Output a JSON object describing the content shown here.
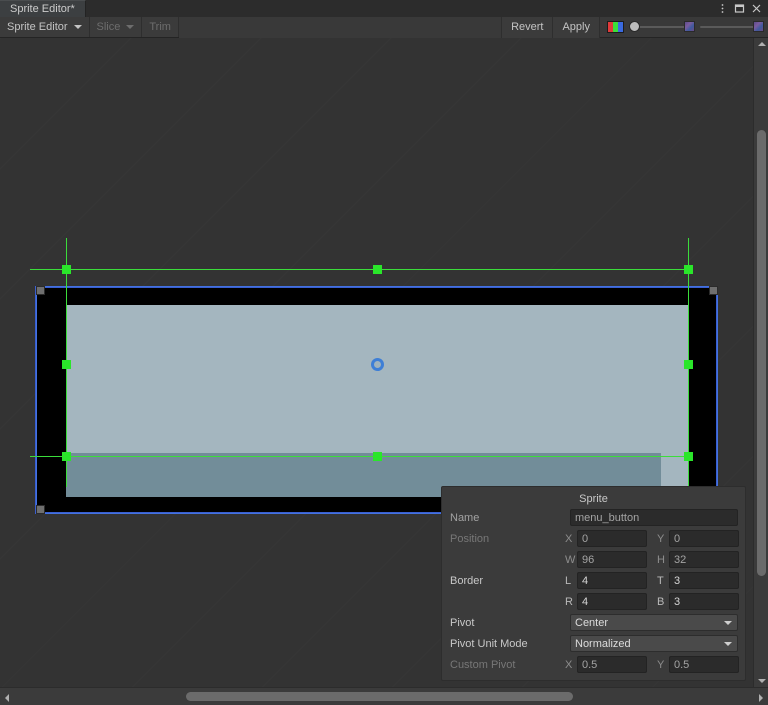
{
  "window": {
    "tab_label": "Sprite Editor*",
    "controls": [
      {
        "name": "kebab-menu",
        "glyph": "⋮"
      },
      {
        "name": "maximize",
        "glyph": "□"
      },
      {
        "name": "close",
        "glyph": "✕"
      }
    ]
  },
  "toolbar": {
    "editor_menu": "Sprite Editor",
    "slice_menu": "Slice",
    "trim_button": "Trim",
    "revert_button": "Revert",
    "apply_button": "Apply",
    "rgb_icon": "rgb-channel-icon",
    "rgb_colors": [
      "#e03a3a",
      "#3ae03a",
      "#3a6ae0"
    ],
    "alpha_slider_value": 0,
    "zoom_slider_value": 38
  },
  "canvas": {
    "texture_background": "#000000",
    "sprite_color_top": "#a4b6bf",
    "sprite_color_bottom": "#728d99",
    "selection_outline_color": "#4472e0",
    "border_guide_color": "#3bdd3b",
    "pivot_color": "#3e7fd6",
    "pivot_label": "pivot-handle"
  },
  "inspector": {
    "title": "Sprite",
    "name_label": "Name",
    "name_value": "menu_button",
    "position_label": "Position",
    "position": {
      "x_label": "X",
      "x_value": "0",
      "y_label": "Y",
      "y_value": "0",
      "w_label": "W",
      "w_value": "96",
      "h_label": "H",
      "h_value": "32"
    },
    "border_label": "Border",
    "border": {
      "l_label": "L",
      "l_value": "4",
      "t_label": "T",
      "t_value": "3",
      "r_label": "R",
      "r_value": "4",
      "b_label": "B",
      "b_value": "3"
    },
    "pivot_label": "Pivot",
    "pivot_value": "Center",
    "pivot_unit_mode_label": "Pivot Unit Mode",
    "pivot_unit_mode_value": "Normalized",
    "custom_pivot_label": "Custom Pivot",
    "custom_pivot": {
      "x_label": "X",
      "x_value": "0.5",
      "y_label": "Y",
      "y_value": "0.5"
    }
  },
  "scrollbars": {
    "vertical_name": "vertical-scrollbar",
    "horizontal_name": "horizontal-scrollbar"
  }
}
